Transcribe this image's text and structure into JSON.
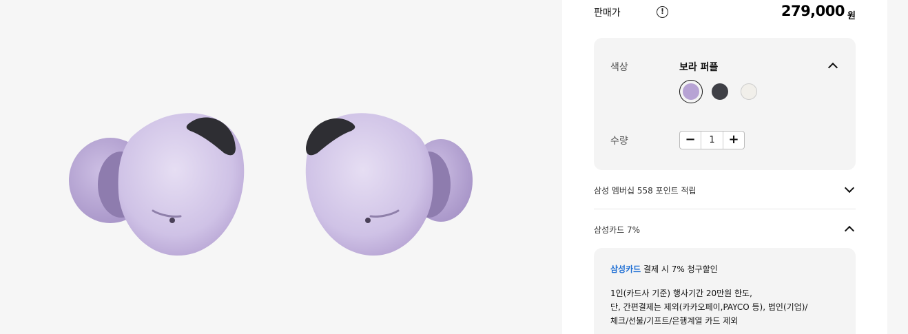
{
  "product": {
    "image_alt": "Galaxy Buds2 Pro earbuds",
    "colors": {
      "bud_main": "#d9cfe9",
      "bud_shadow": "#b8a6d6",
      "mesh": "#2e2e33"
    }
  },
  "price": {
    "label": "판매가",
    "info_icon": "info-icon",
    "value": "279,000",
    "unit": "원"
  },
  "options": {
    "color_label": "색상",
    "color_selected": "보라 퍼플",
    "swatches": [
      {
        "name": "보라 퍼플",
        "hex": "#b7a3d4",
        "selected": true
      },
      {
        "name": "그라파이트",
        "hex": "#3f4046",
        "selected": false
      },
      {
        "name": "화이트",
        "hex": "#f1efea",
        "selected": false
      }
    ],
    "quantity_label": "수량",
    "quantity": "1",
    "minus": "−",
    "plus": "+"
  },
  "membership": {
    "text": "삼성 멤버십 558 포인트 적립"
  },
  "card": {
    "header": "삼성카드 7%",
    "brand": "삼성카드",
    "title_rest": " 결제 시 7% 청구할인",
    "lines": [
      "1인(카드사 기준) 행사기간 20만원 한도,",
      "단, 간편결제는 제외(카카오페이,PAYCO 등), 법인(기업)/",
      "체크/선불/기프트/은행계열 카드 제외"
    ],
    "accent": "#1f6fd4"
  }
}
